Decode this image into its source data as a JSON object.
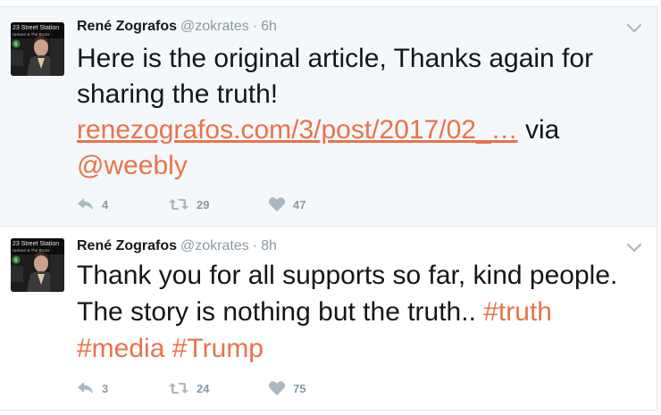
{
  "tweets": [
    {
      "fullname": "René Zografos",
      "username": "@zokrates",
      "separator": "·",
      "time": "6h",
      "text_before": "Here is the original article, Thanks again for sharing the truth! ",
      "link": "renezografos.com/3/post/2017/02_…",
      "text_between": " via ",
      "mention": "@weebly",
      "actions": {
        "reply_count": "4",
        "retweet_count": "29",
        "like_count": "47"
      }
    },
    {
      "fullname": "René Zografos",
      "username": "@zokrates",
      "separator": "·",
      "time": "8h",
      "text": "Thank you for all supports so far, kind people. The story is nothing but the truth.. ",
      "hashtags": [
        "#truth",
        "#media",
        "#Trump"
      ],
      "actions": {
        "reply_count": "3",
        "retweet_count": "24",
        "like_count": "75"
      }
    }
  ],
  "colors": {
    "accent": "#e8734a",
    "muted": "#8899a6",
    "text": "#14171a",
    "bg_highlight": "#f5f8fa",
    "border": "#e1e8ed"
  },
  "icons": [
    "reply-icon",
    "retweet-icon",
    "heart-icon",
    "chevron-down-icon"
  ],
  "avatar_photo_sign_text": [
    "23 Street Station",
    "Uptown & The Bronx",
    "6"
  ]
}
